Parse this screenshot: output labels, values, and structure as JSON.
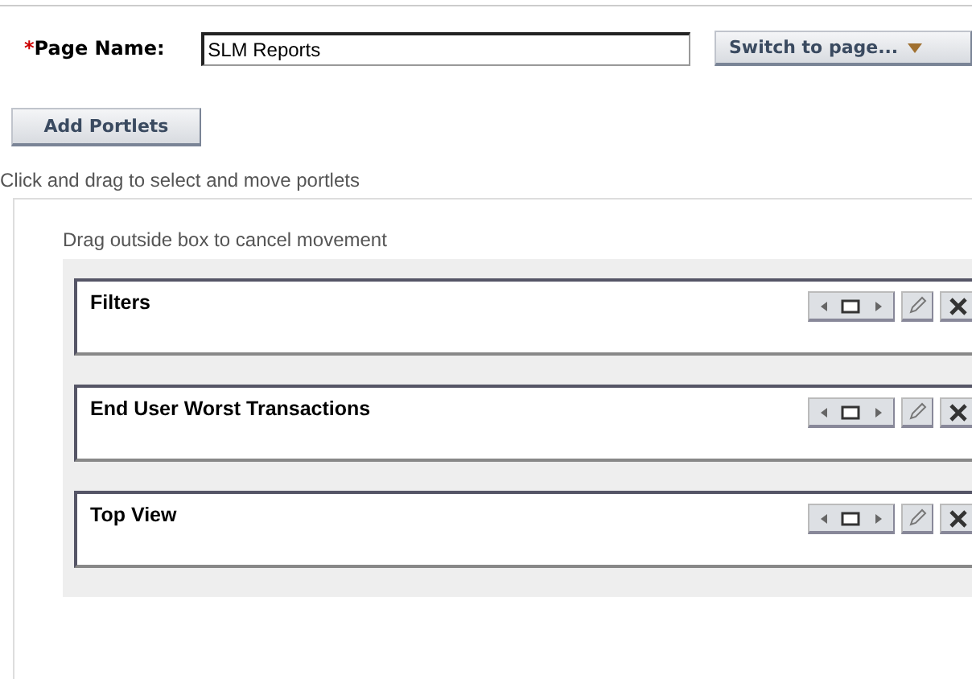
{
  "page_name": {
    "required_mark": "*",
    "label": "Page Name:",
    "value": "SLM Reports"
  },
  "switch_button": {
    "label": "Switch to page..."
  },
  "add_button": {
    "label": "Add Portlets"
  },
  "instruction": "Click and drag to select and move portlets",
  "drag_hint": "Drag outside box to cancel movement",
  "portlets": [
    {
      "title": "Filters"
    },
    {
      "title": "End User Worst Transactions"
    },
    {
      "title": "Top View"
    }
  ]
}
